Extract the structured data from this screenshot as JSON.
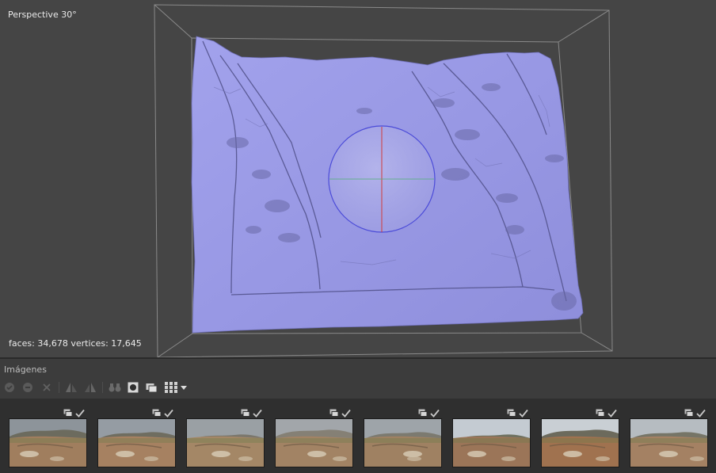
{
  "viewport": {
    "view_label": "Perspective 30°",
    "stats": "faces: 34,678 vertices: 17,645",
    "mesh_color": "#9a9ae6",
    "background_color": "#454545"
  },
  "images_panel": {
    "title": "Imágenes",
    "toolbar": [
      {
        "icon": "check-circle-icon",
        "enabled": false
      },
      {
        "icon": "minus-circle-icon",
        "enabled": false
      },
      {
        "icon": "close-icon",
        "enabled": false
      },
      {
        "icon": "mirror-left-icon",
        "enabled": false
      },
      {
        "icon": "mirror-right-icon",
        "enabled": false
      },
      {
        "icon": "binoculars-icon",
        "enabled": false
      },
      {
        "icon": "mask-icon",
        "enabled": true
      },
      {
        "icon": "photos-icon",
        "enabled": true
      },
      {
        "icon": "grid-view-icon",
        "enabled": true
      },
      {
        "icon": "chevron-down-icon",
        "enabled": true
      }
    ],
    "thumbnails": [
      {
        "sky": "#8d949a",
        "hill": "#6c6b5e",
        "ground": "#a07e5e",
        "aligned": true
      },
      {
        "sky": "#959ca3",
        "hill": "#6f6d60",
        "ground": "#a68161",
        "aligned": true
      },
      {
        "sky": "#9aa0a4",
        "hill": "#7b776c",
        "ground": "#a48766",
        "aligned": true
      },
      {
        "sky": "#a2a6aa",
        "hill": "#858075",
        "ground": "#a28364",
        "aligned": true
      },
      {
        "sky": "#9ea4a9",
        "hill": "#7c7a70",
        "ground": "#9f8162",
        "aligned": true
      },
      {
        "sky": "#c4cbd2",
        "hill": "#6e7160",
        "ground": "#9b7558",
        "aligned": true
      },
      {
        "sky": "#c9cfd4",
        "hill": "#6c6a5c",
        "ground": "#a0724f",
        "aligned": true
      },
      {
        "sky": "#b6bcc1",
        "hill": "#767567",
        "ground": "#a48163",
        "aligned": true
      }
    ]
  }
}
